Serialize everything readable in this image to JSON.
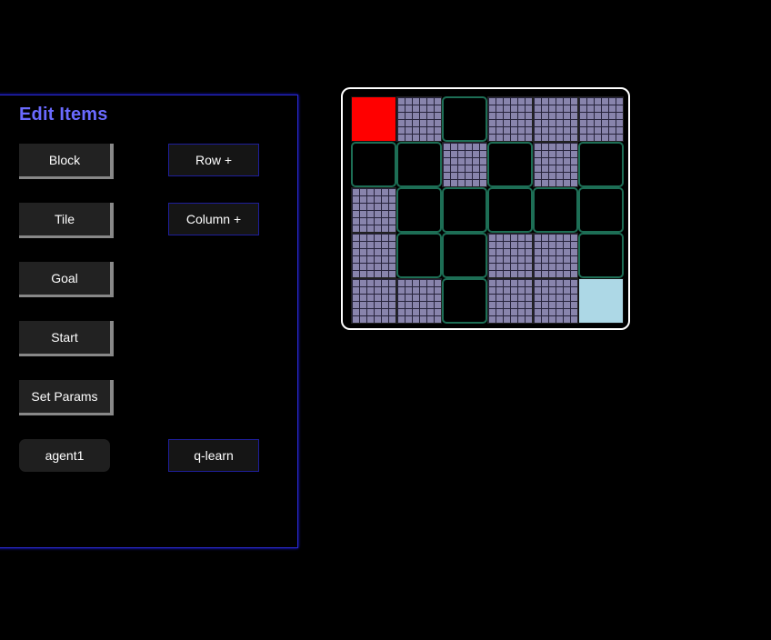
{
  "panel": {
    "title": "Edit Items",
    "buttons": {
      "block": "Block",
      "tile": "Tile",
      "goal": "Goal",
      "start": "Start",
      "set_params": "Set Params",
      "row_plus": "Row +",
      "column_plus": "Column +",
      "agent": "agent1",
      "algorithm": "q-learn"
    }
  },
  "grid": {
    "rows": 5,
    "cols": 6,
    "cells": [
      [
        "start",
        "block",
        "tile",
        "block",
        "block",
        "block"
      ],
      [
        "tile",
        "tile",
        "block",
        "tile",
        "block",
        "tile"
      ],
      [
        "block",
        "tile",
        "tile",
        "tile",
        "tile",
        "tile"
      ],
      [
        "block",
        "tile",
        "tile",
        "block",
        "block",
        "tile"
      ],
      [
        "block",
        "block",
        "tile",
        "block",
        "block",
        "goal"
      ]
    ]
  },
  "colors": {
    "start": "#ff0000",
    "goal": "#add8e6",
    "block": "#8884ac",
    "tile_border": "#1d6e55",
    "panel_border": "#2a2ad0",
    "title": "#6a6aff"
  }
}
